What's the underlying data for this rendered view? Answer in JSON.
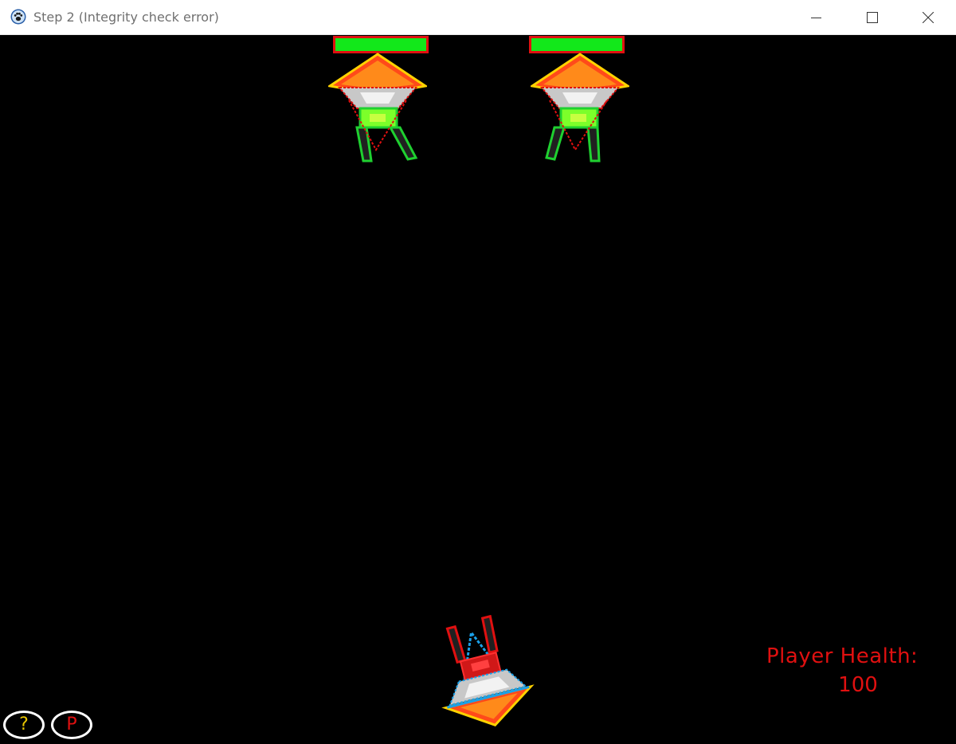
{
  "window": {
    "title": "Step 2 (Integrity check error)"
  },
  "enemies": [
    {
      "health_fraction": 1.0
    },
    {
      "health_fraction": 1.0
    }
  ],
  "hud": {
    "player_health_label": "Player Health:",
    "player_health_value": "100"
  },
  "buttons": {
    "help_label": "?",
    "pause_label": "P"
  },
  "colors": {
    "background": "#000000",
    "health_bar_fill": "#12e81a",
    "health_bar_border": "#e01010",
    "hud_text": "#e01010",
    "help_text": "#e8c400"
  }
}
